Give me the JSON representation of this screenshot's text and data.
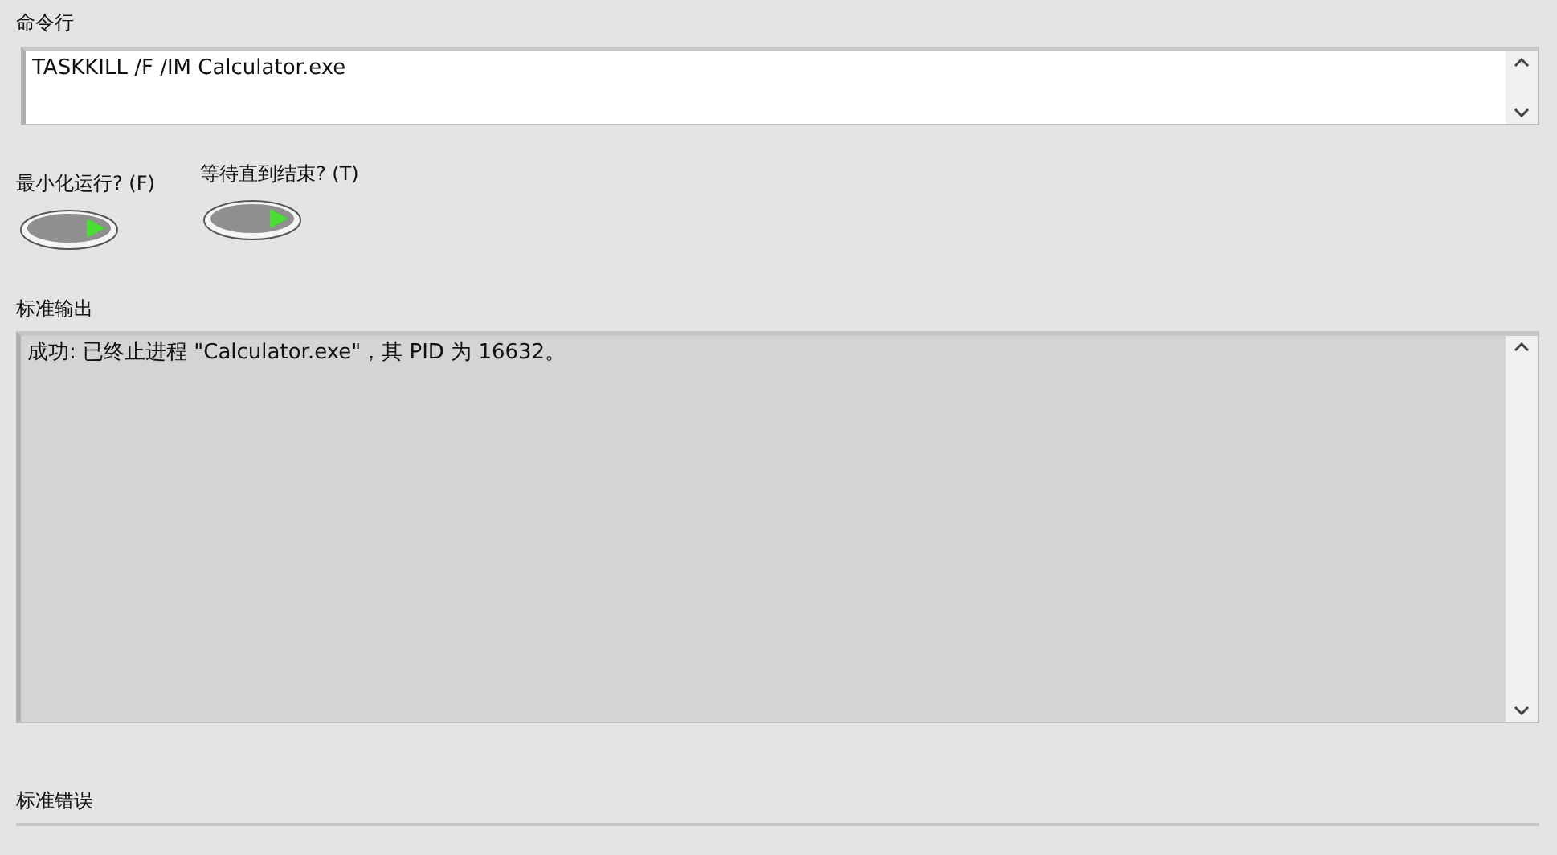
{
  "command_line": {
    "label": "命令行",
    "value": "TASKKILL /F /IM Calculator.exe"
  },
  "switches": [
    {
      "label": "最小化运行? (F)",
      "on": false
    },
    {
      "label": "等待直到结束? (T)",
      "on": false
    }
  ],
  "standard_output": {
    "label": "标准输出",
    "value": "成功: 已终止进程 \"Calculator.exe\"，其 PID 为 16632。"
  },
  "standard_error": {
    "label": "标准错误"
  }
}
